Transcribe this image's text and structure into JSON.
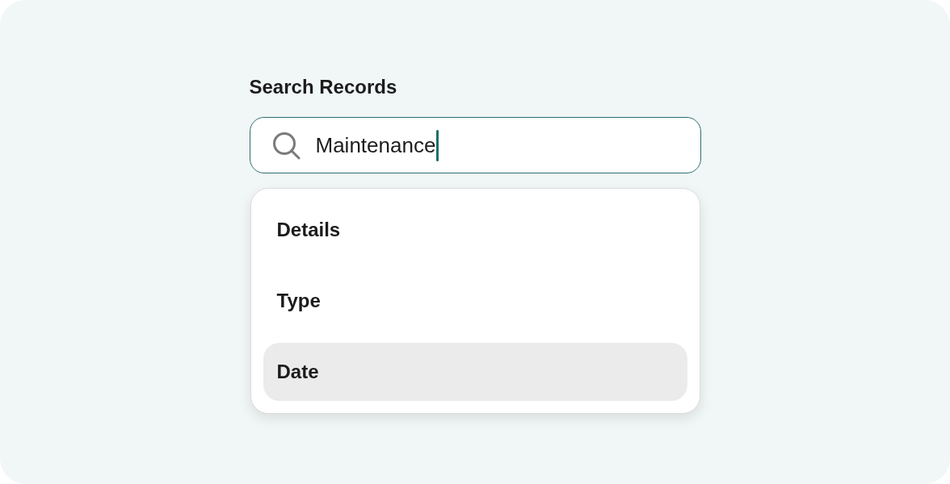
{
  "search": {
    "label": "Search Records",
    "value": "Maintenance",
    "focused": true
  },
  "suggestions": [
    {
      "label": "Details",
      "selected": false
    },
    {
      "label": "Type",
      "selected": false
    },
    {
      "label": "Date",
      "selected": true
    }
  ]
}
